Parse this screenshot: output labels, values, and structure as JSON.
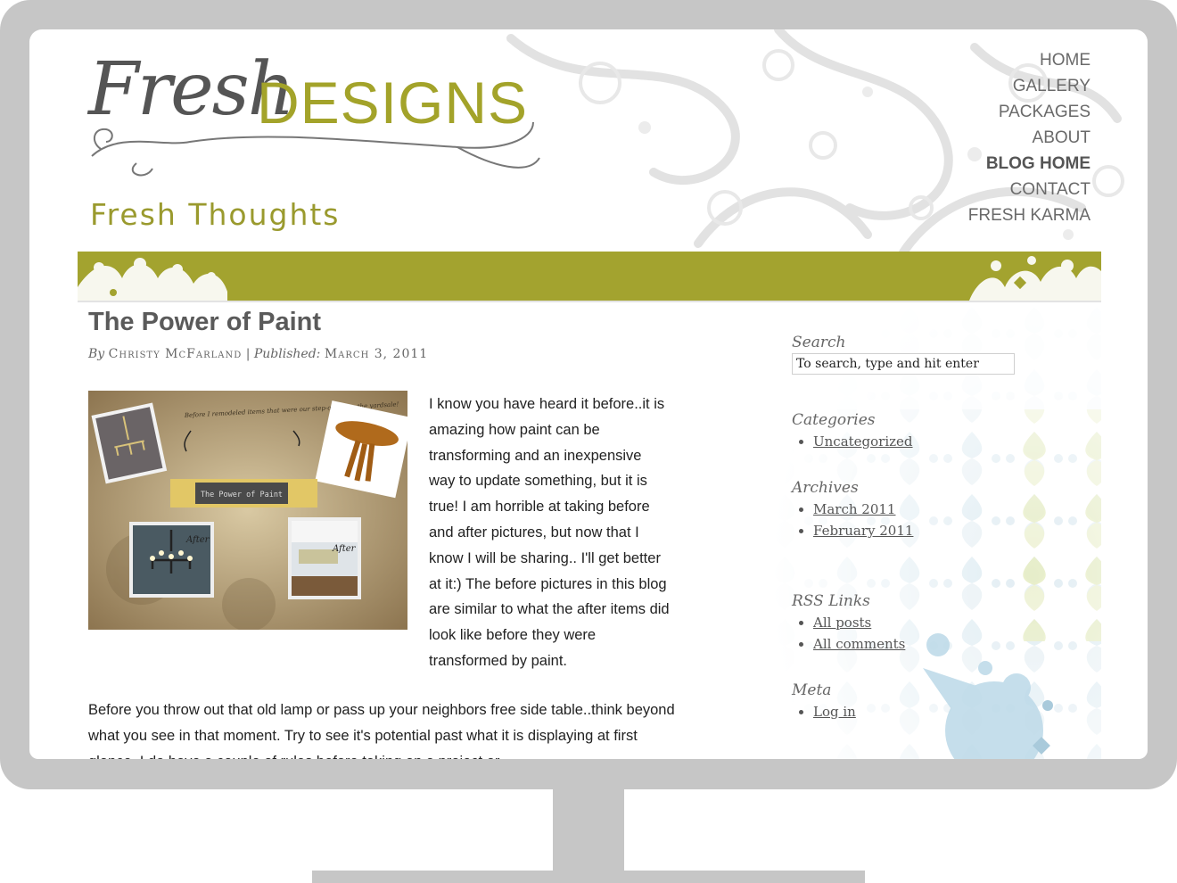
{
  "site": {
    "logo_script": "Fresh",
    "logo_word": "DESIGNS",
    "tagline": "Fresh  Thoughts"
  },
  "nav": {
    "items": [
      {
        "label": "HOME"
      },
      {
        "label": "GALLERY"
      },
      {
        "label": "PACKAGES"
      },
      {
        "label": "ABOUT"
      },
      {
        "label": "BLOG HOME",
        "active": true
      },
      {
        "label": "CONTACT"
      },
      {
        "label": "FRESH KARMA"
      }
    ]
  },
  "post": {
    "title": "The Power of Paint",
    "by_label": "By",
    "author": "Christy McFarland",
    "published_label": "Published:",
    "date": "March 3, 2011",
    "image": {
      "note": "Before I remodeled items that were our step-ons from the yardsale!",
      "label": "The Power of Paint",
      "after_label": "After"
    },
    "para1": "I know you have heard it before..it is amazing how paint can be transforming and an inexpensive way to update something, but it is true! I am horrible at taking before and after pictures, but now that I know I will be sharing.. I'll get better at it:) The before pictures in this blog are similar to what the after items did look like before they were transformed by paint.",
    "para2": "Before you throw out that old lamp or pass up your neighbors free side table..think beyond what you see in that moment. Try to see it's potential past what it is displaying at first glance. I do have a couple of rules before taking on a project or"
  },
  "sidebar": {
    "search": {
      "heading": "Search",
      "value": "To search, type and hit enter"
    },
    "categories": {
      "heading": "Categories",
      "items": [
        "Uncategorized"
      ]
    },
    "archives": {
      "heading": "Archives",
      "items": [
        "March 2011",
        "February 2011"
      ]
    },
    "rss": {
      "heading": "RSS Links",
      "items": [
        "All posts",
        "All comments"
      ]
    },
    "meta": {
      "heading": "Meta",
      "items": [
        "Log in"
      ]
    }
  },
  "colors": {
    "accent_green": "#a3a32f",
    "bezel": "#c6c6c6",
    "damask_blue": "#cfe3ee",
    "damask_yellow": "#e6ecbd"
  }
}
